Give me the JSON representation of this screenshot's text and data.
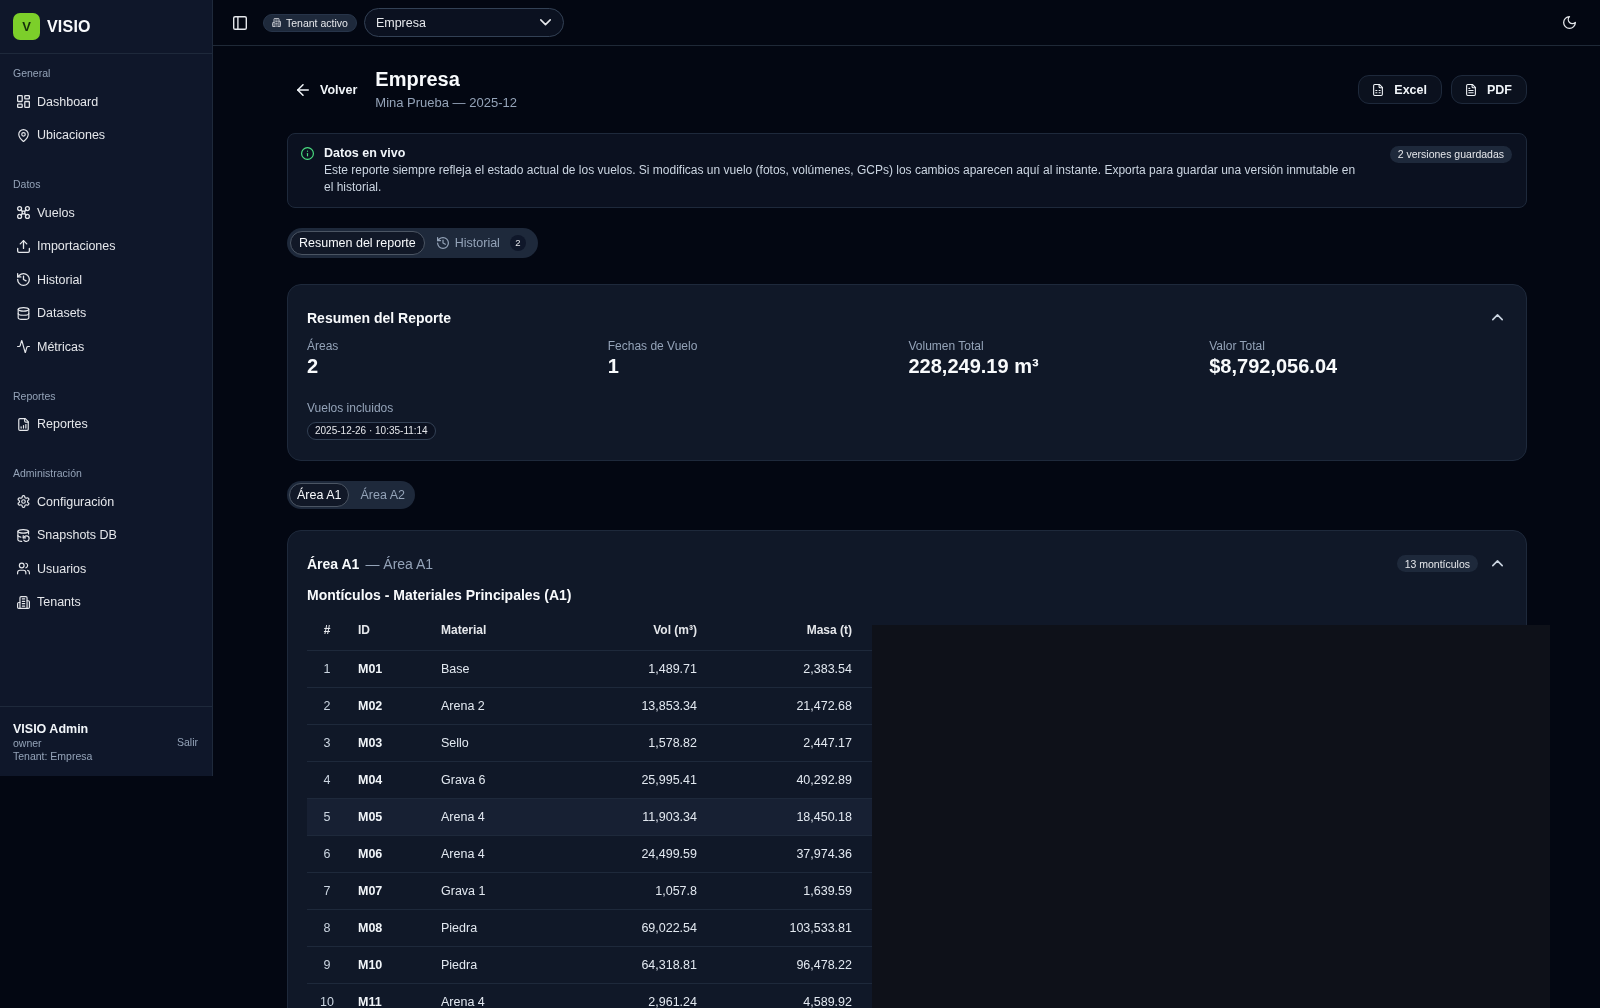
{
  "sidebar": {
    "logo": {
      "mark": "V",
      "name": "VISIO"
    },
    "sections": [
      {
        "label": "General",
        "items": [
          {
            "label": "Dashboard",
            "selected": false
          },
          {
            "label": "Ubicaciones",
            "selected": false
          }
        ]
      },
      {
        "label": "Datos",
        "items": [
          {
            "label": "Vuelos",
            "selected": false
          },
          {
            "label": "Importaciones",
            "selected": false
          },
          {
            "label": "Historial",
            "selected": false
          },
          {
            "label": "Datasets",
            "selected": false
          },
          {
            "label": "Métricas",
            "selected": false
          }
        ]
      },
      {
        "label": "Reportes",
        "items": [
          {
            "label": "Reportes",
            "selected": false
          }
        ]
      },
      {
        "label": "Administración",
        "items": [
          {
            "label": "Configuración",
            "selected": false
          },
          {
            "label": "Snapshots DB",
            "selected": false
          },
          {
            "label": "Usuarios",
            "selected": false
          },
          {
            "label": "Tenants",
            "selected": false
          }
        ]
      }
    ],
    "user": {
      "name": "VISIO Admin",
      "role": "owner",
      "tenant": "Tenant: Empresa",
      "logout": "Salir"
    }
  },
  "topbar": {
    "tenant_badge": "Tenant activo",
    "tenant_select": {
      "value": "Empresa"
    }
  },
  "header": {
    "back": "Volver",
    "title": "Empresa",
    "subtitle": "Mina Prueba — 2025-12",
    "actions": [
      "Excel",
      "PDF"
    ]
  },
  "banner": {
    "title": "Datos en vivo",
    "text": "Este reporte siempre refleja el estado actual de los vuelos. Si modificas un vuelo (fotos, volúmenes, GCPs) los cambios aparecen aquí al instante. Exporta para guardar una versión inmutable en el historial.",
    "badge": "2 versiones guardadas"
  },
  "tabs": [
    {
      "label": "Resumen del reporte",
      "selected": true
    },
    {
      "label": "Historial",
      "count": "2",
      "selected": false
    }
  ],
  "summary": {
    "title": "Resumen del Reporte",
    "expanded": true,
    "stats": [
      {
        "label": "Áreas",
        "value": "2"
      },
      {
        "label": "Fechas de Vuelo",
        "value": "1"
      },
      {
        "label": "Volumen Total",
        "value": "228,249.19 m³"
      },
      {
        "label": "Valor Total",
        "value": "$8,792,056.04"
      }
    ],
    "flights_label": "Vuelos incluidos",
    "flights": [
      "2025-12-26 · 10:35-11:14"
    ]
  },
  "area_tabs": [
    {
      "label": "Área A1",
      "selected": true
    },
    {
      "label": "Área A2",
      "selected": false
    }
  ],
  "area": {
    "title": "Área A1",
    "subtitle": "— Área A1",
    "badge": "13 montículos",
    "expanded": true,
    "table_title": "Montículos - Materiales Principales (A1)",
    "columns": [
      "#",
      "ID",
      "Material",
      "Vol (m³)",
      "Masa (t)"
    ],
    "rows": [
      {
        "cells": [
          "1",
          "M01",
          "Base",
          "1,489.71",
          "2,383.54"
        ],
        "highlighted": false
      },
      {
        "cells": [
          "2",
          "M02",
          "Arena 2",
          "13,853.34",
          "21,472.68"
        ],
        "highlighted": false
      },
      {
        "cells": [
          "3",
          "M03",
          "Sello",
          "1,578.82",
          "2,447.17"
        ],
        "highlighted": false
      },
      {
        "cells": [
          "4",
          "M04",
          "Grava 6",
          "25,995.41",
          "40,292.89"
        ],
        "highlighted": false
      },
      {
        "cells": [
          "5",
          "M05",
          "Arena 4",
          "11,903.34",
          "18,450.18"
        ],
        "highlighted": true
      },
      {
        "cells": [
          "6",
          "M06",
          "Arena 4",
          "24,499.59",
          "37,974.36"
        ],
        "highlighted": false
      },
      {
        "cells": [
          "7",
          "M07",
          "Grava 1",
          "1,057.8",
          "1,639.59"
        ],
        "highlighted": false
      },
      {
        "cells": [
          "8",
          "M08",
          "Piedra",
          "69,022.54",
          "103,533.81"
        ],
        "highlighted": false
      },
      {
        "cells": [
          "9",
          "M10",
          "Piedra",
          "64,318.81",
          "96,478.22"
        ],
        "highlighted": false
      },
      {
        "cells": [
          "10",
          "M11",
          "Arena 4",
          "2,961.24",
          "4,589.92"
        ],
        "highlighted": false
      }
    ]
  }
}
